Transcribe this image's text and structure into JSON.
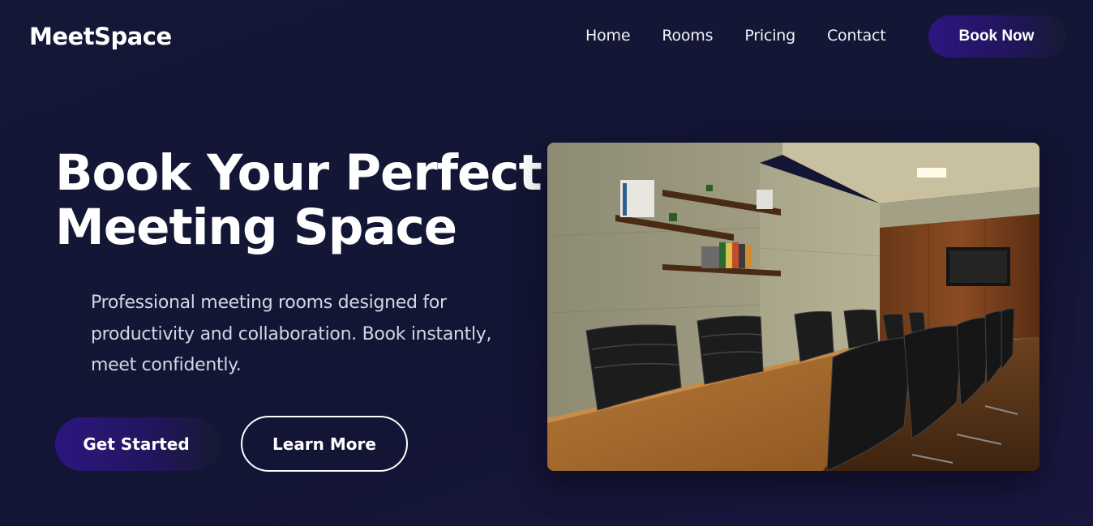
{
  "brand": {
    "name": "MeetSpace"
  },
  "nav": {
    "links": [
      "Home",
      "Rooms",
      "Pricing",
      "Contact"
    ],
    "cta_label": "Book Now"
  },
  "hero": {
    "title_line1": "Book Your Perfect",
    "title_line2": "Meeting Space",
    "subtitle": "Professional meeting rooms designed for productivity and collaboration. Book instantly, meet confidently.",
    "primary_cta": "Get Started",
    "secondary_cta": "Learn More"
  },
  "colors": {
    "background": "#141634",
    "accent": "#2c1680",
    "text": "#ffffff",
    "subtext": "#d4d6e4"
  }
}
